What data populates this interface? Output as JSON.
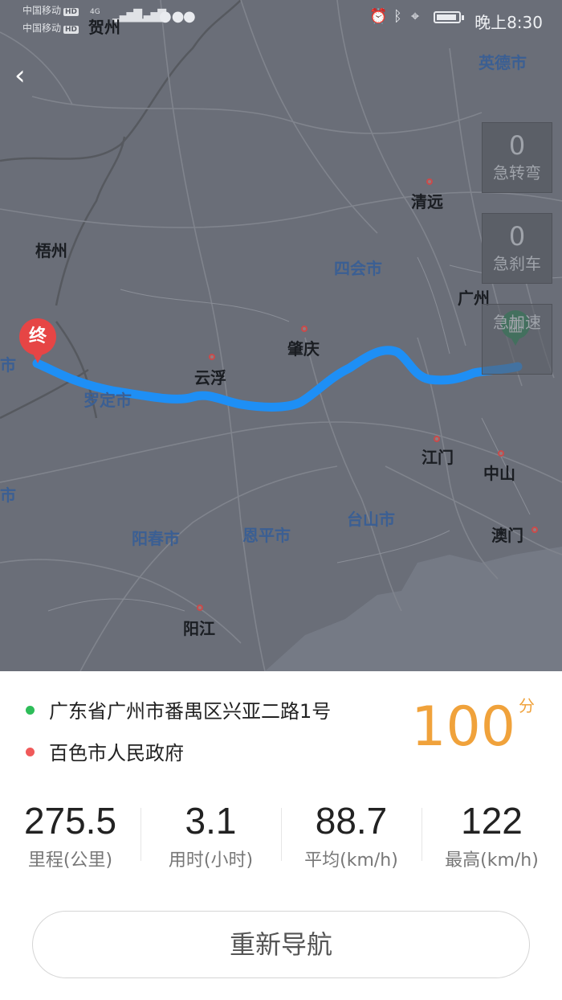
{
  "status_bar": {
    "carrier1": "中国移动",
    "carrier2": "中国移动",
    "hd": "HD",
    "network": "4G",
    "time": "晚上8:30"
  },
  "map": {
    "cities_dark": [
      {
        "name": "贺州"
      },
      {
        "name": "梧州"
      },
      {
        "name": "清远"
      },
      {
        "name": "广州"
      },
      {
        "name": "肇庆"
      },
      {
        "name": "云浮"
      },
      {
        "name": "江门"
      },
      {
        "name": "中山"
      },
      {
        "name": "阳江"
      },
      {
        "name": "澳门"
      }
    ],
    "cities_blue": [
      {
        "name": "英德市"
      },
      {
        "name": "四会市"
      },
      {
        "name": "台山市"
      },
      {
        "name": "恩平市"
      },
      {
        "name": "阳春市"
      },
      {
        "name": "罗定市"
      },
      {
        "name": "市"
      },
      {
        "name": "市"
      }
    ],
    "end_pin_label": "终",
    "counters": [
      {
        "value": "0",
        "label": "急转弯"
      },
      {
        "value": "0",
        "label": "急刹车"
      },
      {
        "value": "",
        "label": "急加速"
      }
    ],
    "route_color": "#1e8ff5"
  },
  "trip": {
    "start_address": "广东省广州市番禺区兴亚二路1号",
    "end_address": "百色市人民政府",
    "start_color": "#2ebd59",
    "end_color": "#f05a5a",
    "score": "100",
    "score_unit": "分",
    "stats": [
      {
        "value": "275.5",
        "label": "里程(公里)"
      },
      {
        "value": "3.1",
        "label": "用时(小时)"
      },
      {
        "value": "88.7",
        "label": "平均(km/h)"
      },
      {
        "value": "122",
        "label": "最高(km/h)"
      }
    ],
    "renavigate_label": "重新导航"
  }
}
